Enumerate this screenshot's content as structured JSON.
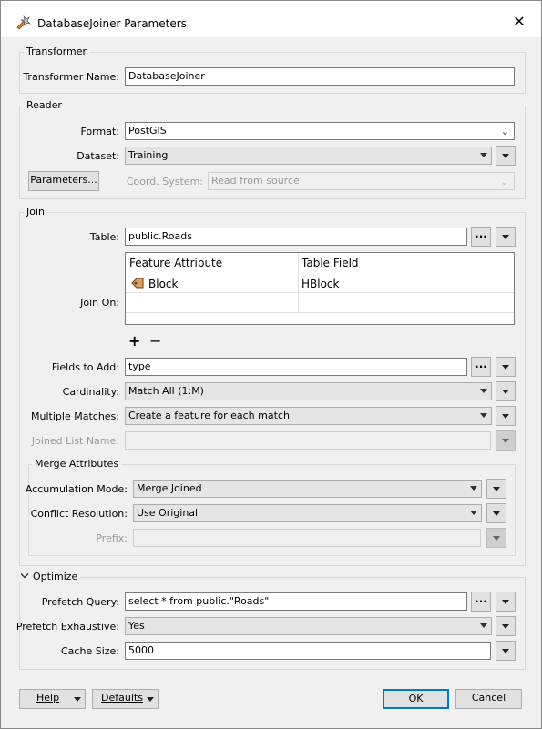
{
  "window": {
    "title": "DatabaseJoiner Parameters",
    "close": "✕"
  },
  "transformer": {
    "group": "Transformer",
    "name_label": "Transformer Name:",
    "name_value": "DatabaseJoiner"
  },
  "reader": {
    "group": "Reader",
    "format_label": "Format:",
    "format_value": "PostGIS",
    "dataset_label": "Dataset:",
    "dataset_value": "Training",
    "parameters_button": "Parameters...",
    "coord_label": "Coord. System:",
    "coord_value": "Read from source"
  },
  "join": {
    "group": "Join",
    "table_label": "Table:",
    "table_value": "public.Roads",
    "ellipsis": "...",
    "join_on_label": "Join On:",
    "columns": [
      "Feature Attribute",
      "Table Field"
    ],
    "rows": [
      {
        "feature_attribute": "Block",
        "table_field": "HBlock"
      }
    ],
    "add": "+",
    "remove": "−",
    "fields_label": "Fields to Add:",
    "fields_value": "type",
    "cardinality_label": "Cardinality:",
    "cardinality_value": "Match All (1:M)",
    "multiple_label": "Multiple Matches:",
    "multiple_value": "Create a feature for each match",
    "joined_list_label": "Joined List Name:",
    "joined_list_value": ""
  },
  "merge": {
    "group": "Merge Attributes",
    "accumulation_label": "Accumulation Mode:",
    "accumulation_value": "Merge Joined",
    "conflict_label": "Conflict Resolution:",
    "conflict_value": "Use Original",
    "prefix_label": "Prefix:",
    "prefix_value": ""
  },
  "optimize": {
    "group": "Optimize",
    "prefetch_query_label": "Prefetch Query:",
    "prefetch_query_value": "select * from public.\"Roads\"",
    "prefetch_exhaustive_label": "Prefetch Exhaustive:",
    "prefetch_exhaustive_value": "Yes",
    "cache_label": "Cache Size:",
    "cache_value": "5000"
  },
  "footer": {
    "help": "Help",
    "defaults": "Defaults",
    "ok": "OK",
    "cancel": "Cancel"
  },
  "colors": {
    "ok_border": "#0078d7",
    "input_border": "#7a7a7a",
    "disabled_text": "#9a9a9a"
  },
  "icons": {
    "attribute": "attribute-tag-icon",
    "app": "fme-transformer-icon"
  }
}
